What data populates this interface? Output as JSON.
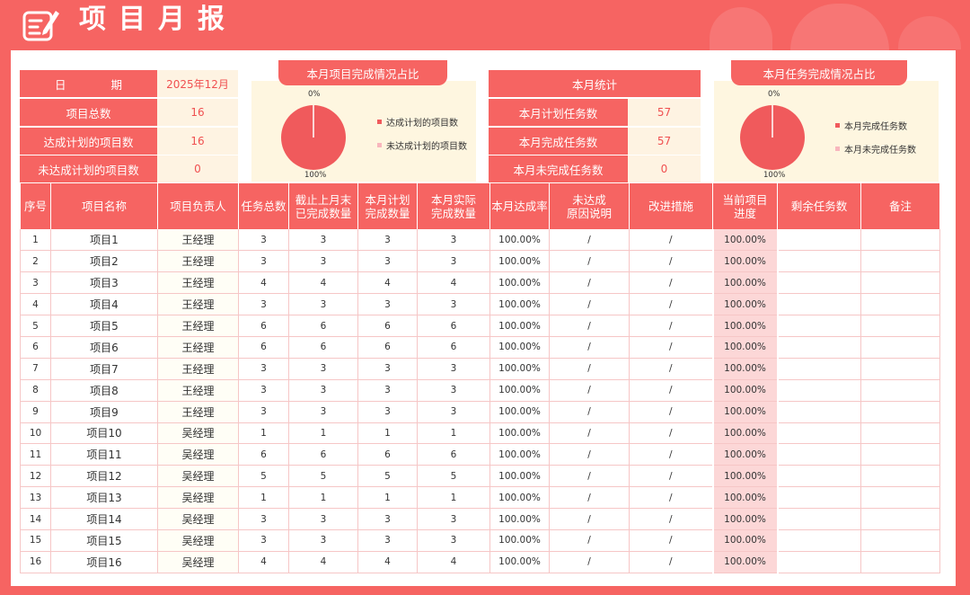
{
  "page": {
    "title": "项目月报"
  },
  "summary": {
    "date_label": "日　　　　期",
    "date_value": "2025年12月",
    "total_label": "项目总数",
    "total_value": "16",
    "achieved_label": "达成计划的项目数",
    "achieved_value": "16",
    "unachieved_label": "未达成计划的项目数",
    "unachieved_value": "0"
  },
  "project_chart": {
    "title": "本月项目完成情况占比",
    "top_label": "0%",
    "bottom_label": "100%",
    "legend": [
      "达成计划的项目数",
      "未达成计划的项目数"
    ],
    "colors": [
      "#f05a5c",
      "#f8b6bd"
    ]
  },
  "stats": {
    "title": "本月统计",
    "planned_label": "本月计划任务数",
    "planned_value": "57",
    "completed_label": "本月完成任务数",
    "completed_value": "57",
    "uncompleted_label": "本月未完成任务数",
    "uncompleted_value": "0"
  },
  "task_chart": {
    "title": "本月任务完成情况占比",
    "top_label": "0%",
    "bottom_label": "100%",
    "legend": [
      "本月完成任务数",
      "本月未完成任务数"
    ],
    "colors": [
      "#f05a5c",
      "#f8b6bd"
    ]
  },
  "table": {
    "headers": [
      "序号",
      "项目名称",
      "项目负责人",
      "任务总数",
      "截止上月末\n已完成数量",
      "本月计划\n完成数量",
      "本月实际\n完成数量",
      "本月达成率",
      "未达成\n原因说明",
      "改进措施",
      "当前项目\n进度",
      "剩余任务数",
      "备注"
    ],
    "rows": [
      [
        "1",
        "项目1",
        "王经理",
        "3",
        "3",
        "3",
        "3",
        "100.00%",
        "/",
        "/",
        "100.00%",
        "",
        ""
      ],
      [
        "2",
        "项目2",
        "王经理",
        "3",
        "3",
        "3",
        "3",
        "100.00%",
        "/",
        "/",
        "100.00%",
        "",
        ""
      ],
      [
        "3",
        "项目3",
        "王经理",
        "4",
        "4",
        "4",
        "4",
        "100.00%",
        "/",
        "/",
        "100.00%",
        "",
        ""
      ],
      [
        "4",
        "项目4",
        "王经理",
        "3",
        "3",
        "3",
        "3",
        "100.00%",
        "/",
        "/",
        "100.00%",
        "",
        ""
      ],
      [
        "5",
        "项目5",
        "王经理",
        "6",
        "6",
        "6",
        "6",
        "100.00%",
        "/",
        "/",
        "100.00%",
        "",
        ""
      ],
      [
        "6",
        "项目6",
        "王经理",
        "6",
        "6",
        "6",
        "6",
        "100.00%",
        "/",
        "/",
        "100.00%",
        "",
        ""
      ],
      [
        "7",
        "项目7",
        "王经理",
        "3",
        "3",
        "3",
        "3",
        "100.00%",
        "/",
        "/",
        "100.00%",
        "",
        ""
      ],
      [
        "8",
        "项目8",
        "王经理",
        "3",
        "3",
        "3",
        "3",
        "100.00%",
        "/",
        "/",
        "100.00%",
        "",
        ""
      ],
      [
        "9",
        "项目9",
        "王经理",
        "3",
        "3",
        "3",
        "3",
        "100.00%",
        "/",
        "/",
        "100.00%",
        "",
        ""
      ],
      [
        "10",
        "项目10",
        "吴经理",
        "1",
        "1",
        "1",
        "1",
        "100.00%",
        "/",
        "/",
        "100.00%",
        "",
        ""
      ],
      [
        "11",
        "项目11",
        "吴经理",
        "6",
        "6",
        "6",
        "6",
        "100.00%",
        "/",
        "/",
        "100.00%",
        "",
        ""
      ],
      [
        "12",
        "项目12",
        "吴经理",
        "5",
        "5",
        "5",
        "5",
        "100.00%",
        "/",
        "/",
        "100.00%",
        "",
        ""
      ],
      [
        "13",
        "项目13",
        "吴经理",
        "1",
        "1",
        "1",
        "1",
        "100.00%",
        "/",
        "/",
        "100.00%",
        "",
        ""
      ],
      [
        "14",
        "项目14",
        "吴经理",
        "3",
        "3",
        "3",
        "3",
        "100.00%",
        "/",
        "/",
        "100.00%",
        "",
        ""
      ],
      [
        "15",
        "项目15",
        "吴经理",
        "3",
        "3",
        "3",
        "3",
        "100.00%",
        "/",
        "/",
        "100.00%",
        "",
        ""
      ],
      [
        "16",
        "项目16",
        "吴经理",
        "4",
        "4",
        "4",
        "4",
        "100.00%",
        "/",
        "/",
        "100.00%",
        "",
        ""
      ]
    ]
  }
}
